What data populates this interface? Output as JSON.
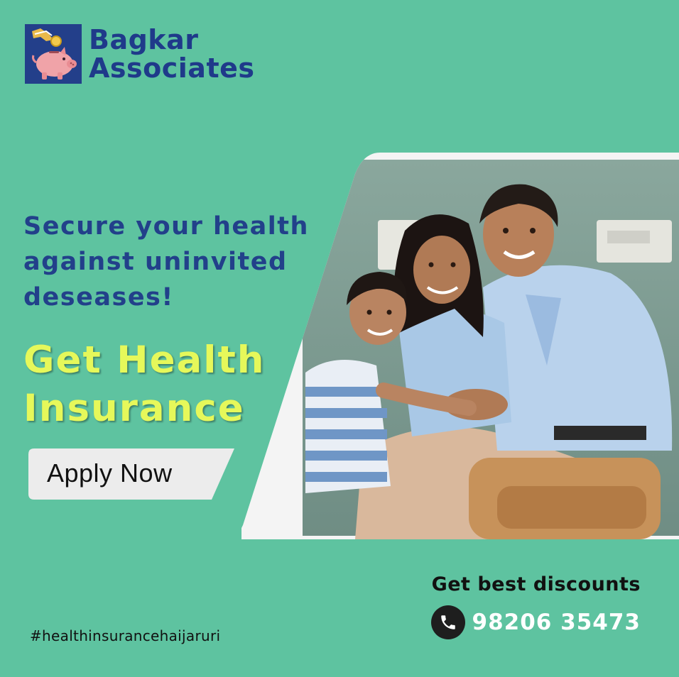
{
  "brand": {
    "line1": "Bagkar",
    "line2": "Associates",
    "logo_icon": "piggy-bank-coin-icon"
  },
  "tagline": {
    "line1": "Secure your health",
    "line2": "against uninvited",
    "line3": "deseases!"
  },
  "headline": {
    "line1": "Get Health",
    "line2": "Insurance"
  },
  "cta": {
    "label": "Apply Now"
  },
  "contact": {
    "discount_text": "Get best discounts",
    "phone": "98206 35473",
    "phone_icon": "phone-icon"
  },
  "hashtag": "#healthinsurancehaijaruri",
  "colors": {
    "background": "#5ec3a0",
    "brand_navy": "#22408a",
    "headline_yellow": "#e6f85a"
  }
}
